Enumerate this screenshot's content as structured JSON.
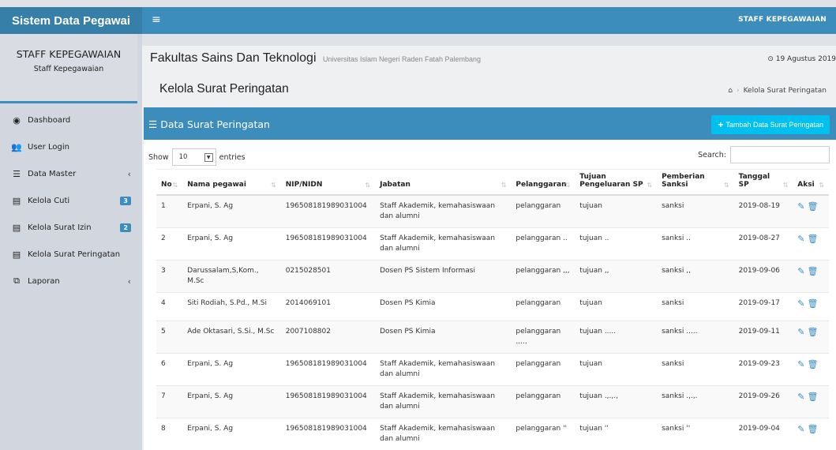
{
  "app": {
    "brand": "Sistem Data Pegawai",
    "user_menu": "STAFF KEPEGAWAIAN"
  },
  "sidebar": {
    "user_name": "STAFF KEPEGAWAIAN",
    "user_role": "Staff Kepegawaian",
    "items": [
      {
        "label": "Dashboard",
        "icon": "dashboard-icon",
        "glyph": "◉"
      },
      {
        "label": "User Login",
        "icon": "users-icon",
        "glyph": "👥"
      },
      {
        "label": "Data Master",
        "icon": "list-icon",
        "glyph": "☰",
        "chevron": "‹"
      },
      {
        "label": "Kelola Cuti",
        "icon": "table-icon",
        "glyph": "▤",
        "badge": "3"
      },
      {
        "label": "Kelola Surat Izin",
        "icon": "table-icon",
        "glyph": "▤",
        "badge": "2"
      },
      {
        "label": "Kelola Surat Peringatan",
        "icon": "table-icon",
        "glyph": "▤"
      },
      {
        "label": "Laporan",
        "icon": "copy-icon",
        "glyph": "⧉",
        "chevron": "‹"
      }
    ]
  },
  "header": {
    "faculty": "Fakultas Sains Dan Teknologi",
    "university": "Universitas Islam Negeri Raden Fatah Palembang",
    "date": "⊙ 19 Agustus 2019"
  },
  "page": {
    "title": "Kelola Surat Peringatan",
    "breadcrumb_home_icon": "home-icon",
    "breadcrumb_current": "Kelola Surat Peringatan"
  },
  "box": {
    "title": "Data Surat Peringatan",
    "add_button": "Tambah Data Surat Peringatan"
  },
  "table_controls": {
    "show_label": "Show",
    "page_size": "10",
    "entries_label": "entries",
    "search_label": "Search:",
    "search_value": ""
  },
  "table": {
    "columns": [
      "No",
      "Nama pegawai",
      "NIP/NIDN",
      "Jabatan",
      "Pelanggaran",
      "Tujuan Pengeluaran SP",
      "Pemberian Sanksi",
      "Tanggal SP",
      "Aksi"
    ],
    "rows": [
      [
        "1",
        "Erpani, S. Ag",
        "196508181989031004",
        "Staff Akademik, kemahasiswaan dan alumni",
        "pelanggaran",
        "tujuan",
        "sanksi",
        "2019-08-19"
      ],
      [
        "2",
        "Erpani, S. Ag",
        "196508181989031004",
        "Staff Akademik, kemahasiswaan dan alumni",
        "pelanggaran ..",
        "tujuan ..",
        "sanksi ..",
        "2019-08-27"
      ],
      [
        "3",
        "Darussalam,S,Kom., M.Sc",
        "0215028501",
        "Dosen PS Sistem Informasi",
        "pelanggaran ,,,",
        "tujuan ,,",
        "sanksi ,,",
        "2019-09-06"
      ],
      [
        "4",
        "Siti Rodiah, S.Pd., M.Si",
        "2014069101",
        "Dosen PS Kimia",
        "pelanggaran",
        "tujuan",
        "sanksi",
        "2019-09-17"
      ],
      [
        "5",
        "Ade Oktasari, S.Si., M.Sc",
        "2007108802",
        "Dosen PS Kimia",
        "pelanggaran .....",
        "tujuan .....",
        "sanksi .....",
        "2019-09-11"
      ],
      [
        "6",
        "Erpani, S. Ag",
        "196508181989031004",
        "Staff Akademik, kemahasiswaan dan alumni",
        "pelanggaran",
        "tujuan",
        "sanksi",
        "2019-09-23"
      ],
      [
        "7",
        "Erpani, S. Ag",
        "196508181989031004",
        "Staff Akademik, kemahasiswaan dan alumni",
        "pelanggaran",
        "tujuan .,.,.,",
        "sanksi .,.,.",
        "2019-09-26"
      ],
      [
        "8",
        "Erpani, S. Ag",
        "196508181989031004",
        "Staff Akademik, kemahasiswaan dan alumni",
        "pelanggaran ''",
        "tujuan ''",
        "sanksi ''",
        "2019-09-04"
      ]
    ],
    "action_icons": [
      "edit-icon",
      "trash-icon"
    ]
  },
  "colors": {
    "primary": "#3c8dbc",
    "brand_dark": "#367fa9",
    "info": "#00c0ef",
    "sidebar_bg": "#d2d6de"
  }
}
